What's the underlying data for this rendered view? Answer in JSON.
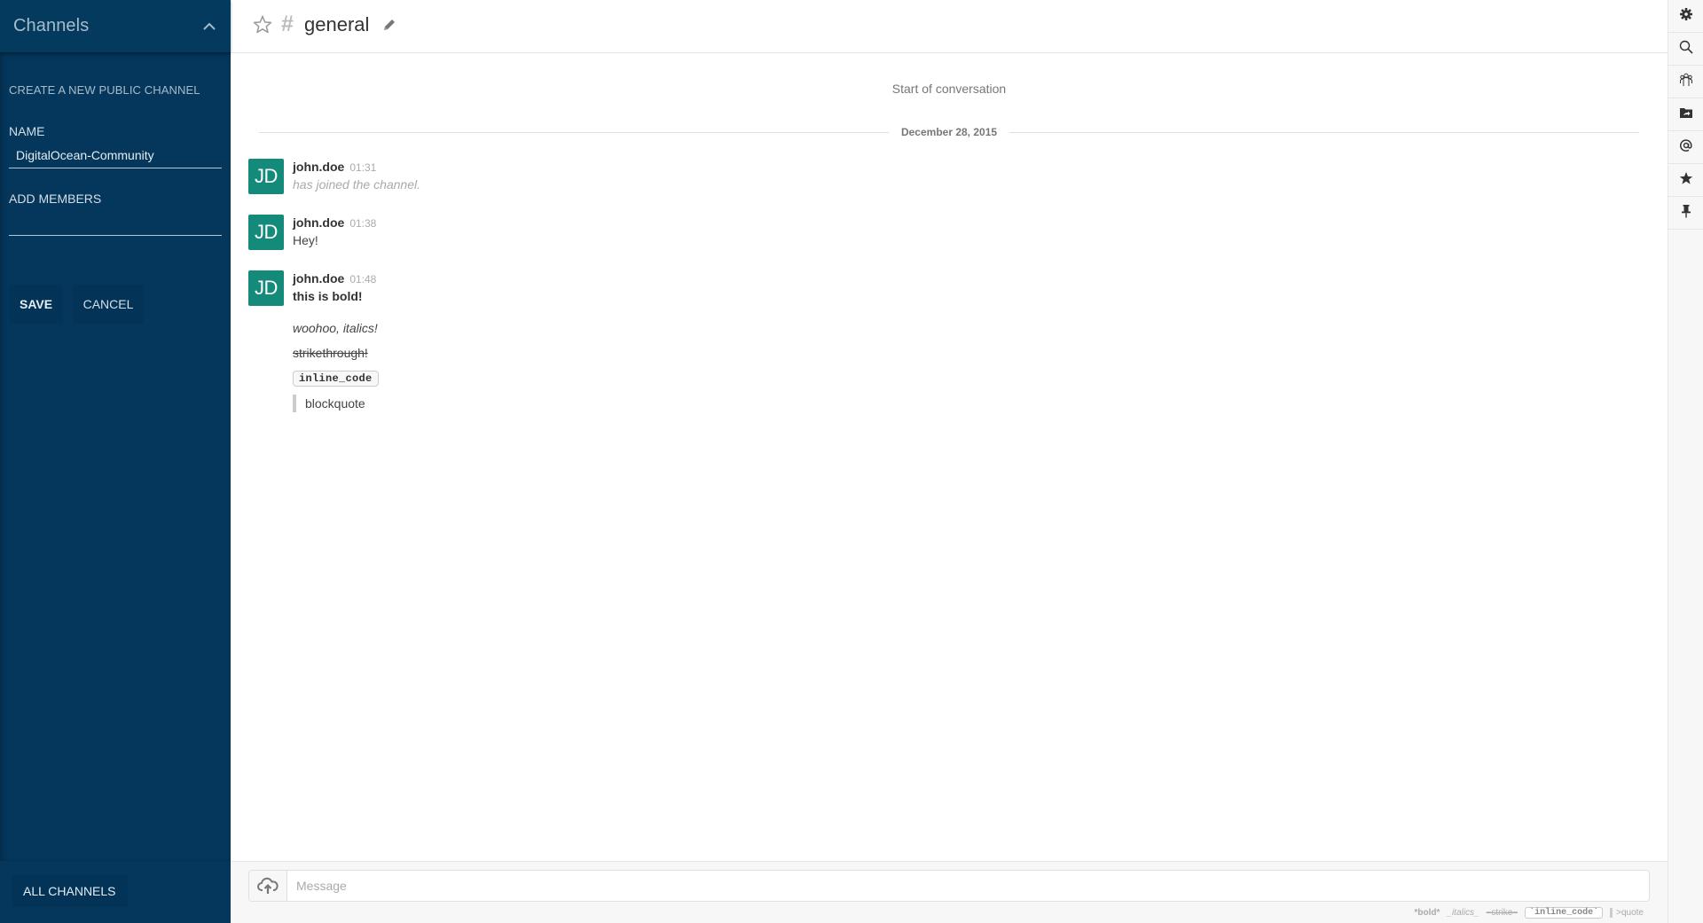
{
  "sidebar": {
    "title": "Channels",
    "collapse_icon": "chevron-up-icon",
    "create_channel": {
      "section_title": "CREATE A NEW PUBLIC CHANNEL",
      "name_label": "NAME",
      "name_value": "DigitalOcean-Community",
      "members_label": "ADD MEMBERS",
      "members_value": "",
      "save_label": "SAVE",
      "cancel_label": "CANCEL"
    },
    "all_channels_label": "ALL CHANNELS"
  },
  "header": {
    "favorite_icon": "star-outline-icon",
    "channel_prefix": "#",
    "channel_name": "general",
    "edit_icon": "pencil-icon"
  },
  "conversation": {
    "start_text": "Start of conversation",
    "date_divider": "December 28, 2015",
    "messages": [
      {
        "avatar": "JD",
        "user": "john.doe",
        "time": "01:31",
        "text": "has joined the channel.",
        "type": "system"
      },
      {
        "avatar": "JD",
        "user": "john.doe",
        "time": "01:38",
        "text": "Hey!",
        "type": "normal"
      },
      {
        "avatar": "JD",
        "user": "john.doe",
        "time": "01:48",
        "text": "this is bold!",
        "type": "bold",
        "extra": {
          "italic": "woohoo, italics!",
          "strike": "strikethrough!",
          "code": "inline_code",
          "quote": "blockquote"
        }
      }
    ]
  },
  "composer": {
    "upload_icon": "cloud-upload-icon",
    "placeholder": "Message",
    "value": "",
    "hints": {
      "bold": "*bold*",
      "italic": "_italics_",
      "strike": "~strike~",
      "code": "`inline_code`",
      "quote": ">quote"
    }
  },
  "toolbar": {
    "items": [
      {
        "name": "settings",
        "icon": "gear-icon"
      },
      {
        "name": "search",
        "icon": "search-icon"
      },
      {
        "name": "members",
        "icon": "users-icon"
      },
      {
        "name": "files",
        "icon": "shared-folder-icon"
      },
      {
        "name": "mentions",
        "icon": "at-icon"
      },
      {
        "name": "starred",
        "icon": "star-icon"
      },
      {
        "name": "pinned",
        "icon": "pin-icon"
      }
    ]
  },
  "colors": {
    "sidebar_bg": "#04375b",
    "avatar_bg": "#138a7a",
    "text": "#444444",
    "muted": "#aaaaaa"
  }
}
